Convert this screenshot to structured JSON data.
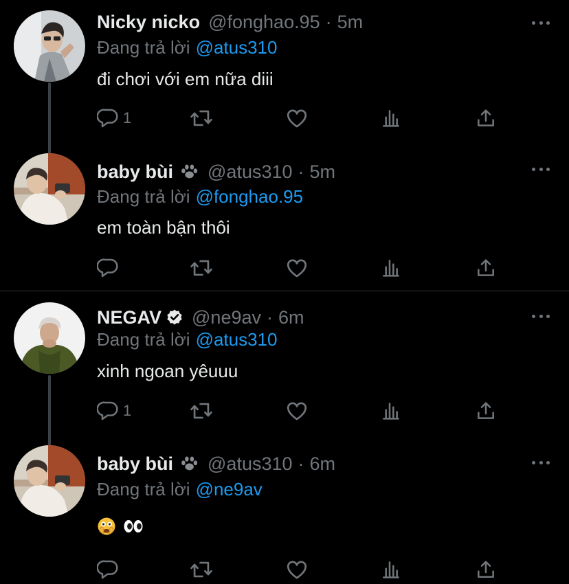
{
  "tweets": [
    {
      "name": "Nicky nicko",
      "handle": "@fonghao.95",
      "sep": "·",
      "time": "5m",
      "replying_prefix": "Đang trả lời",
      "replying_to": "@atus310",
      "text": "đi chơi với em nữa diii",
      "reply_count": "1"
    },
    {
      "name": "baby bùi",
      "handle": "@atus310",
      "sep": "·",
      "time": "5m",
      "replying_prefix": "Đang trả lời",
      "replying_to": "@fonghao.95",
      "text": "em toàn bận thôi",
      "reply_count": ""
    },
    {
      "name": "NEGAV",
      "handle": "@ne9av",
      "sep": "·",
      "time": "6m",
      "replying_prefix": "Đang trả lời",
      "replying_to": "@atus310",
      "text": "xinh ngoan yêuuu",
      "reply_count": "1"
    },
    {
      "name": "baby bùi",
      "handle": "@atus310",
      "sep": "·",
      "time": "6m",
      "replying_prefix": "Đang trả lời",
      "replying_to": "@ne9av",
      "text": "",
      "emojis": [
        "flushed-face",
        "eyes"
      ],
      "reply_count": ""
    }
  ],
  "icons": [
    "reply-icon",
    "retweet-icon",
    "like-icon",
    "analytics-icon",
    "share-icon",
    "more-icon",
    "paw-icon",
    "verified-icon"
  ],
  "colors": {
    "background": "#000000",
    "text": "#e7e9ea",
    "muted": "#71767b",
    "link": "#1d9bf0",
    "divider": "#2f3336"
  }
}
